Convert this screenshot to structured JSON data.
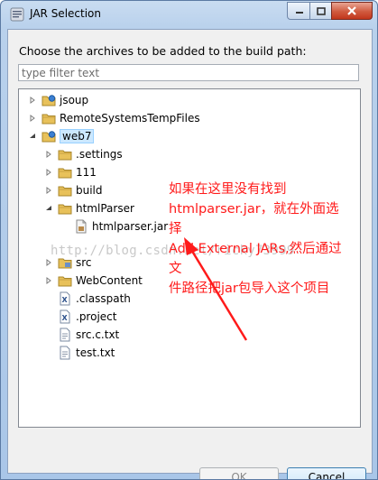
{
  "window": {
    "title": "JAR Selection"
  },
  "dialog": {
    "prompt": "Choose the archives to be added to the build path:",
    "filter_placeholder": "type filter text",
    "filter_value": ""
  },
  "tree": {
    "items": [
      {
        "label": "jsoup",
        "icon": "project-icon",
        "expanded": false
      },
      {
        "label": "RemoteSystemsTempFiles",
        "icon": "folder-icon",
        "expanded": false
      },
      {
        "label": "web7",
        "icon": "project-icon",
        "expanded": true,
        "selected": true
      },
      {
        "label": ".settings",
        "icon": "folder-icon",
        "expanded": false
      },
      {
        "label": "111",
        "icon": "folder-icon",
        "expanded": false
      },
      {
        "label": "build",
        "icon": "folder-icon",
        "expanded": false
      },
      {
        "label": "htmlParser",
        "icon": "folder-icon",
        "expanded": true
      },
      {
        "label": "htmlparser.jar",
        "icon": "jar-file-icon",
        "expanded": null
      },
      {
        "label": "src",
        "icon": "source-folder-icon",
        "expanded": false
      },
      {
        "label": "WebContent",
        "icon": "folder-icon",
        "expanded": false
      },
      {
        "label": ".classpath",
        "icon": "xml-file-icon",
        "expanded": null
      },
      {
        "label": ".project",
        "icon": "xml-file-icon",
        "expanded": null
      },
      {
        "label": "src.c.txt",
        "icon": "text-file-icon",
        "expanded": null
      },
      {
        "label": "test.txt",
        "icon": "text-file-icon",
        "expanded": null
      }
    ]
  },
  "annotation": {
    "lines": [
      "如果在这里没有找到",
      "htmlparser.jar，就在外面选择",
      "Add External JARs,然后通过文",
      "件路径把jar包导入这个项目"
    ],
    "color": "#ff1a1a"
  },
  "watermark": "http://blog.csdn.net/ricky73999",
  "buttons": {
    "ok": "OK",
    "cancel": "Cancel"
  },
  "colors": {
    "selection": "#cce8ff",
    "folder": "#e8c15a",
    "title_bar": "#b9d1ec",
    "close_button": "#c2361c"
  }
}
